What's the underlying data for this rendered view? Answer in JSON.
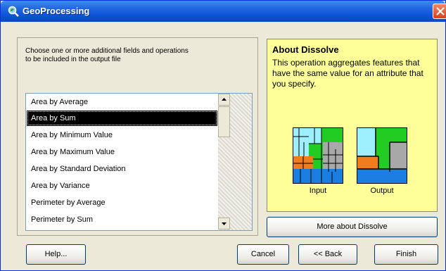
{
  "window": {
    "title": "GeoProcessing"
  },
  "left_panel": {
    "instructions": "Choose one or more additional fields and operations to be included in the output file",
    "list_items": [
      {
        "label": "Area by Average",
        "selected": false
      },
      {
        "label": "Area by Sum",
        "selected": true
      },
      {
        "label": "Area by Minimum Value",
        "selected": false
      },
      {
        "label": "Area by Maximum Value",
        "selected": false
      },
      {
        "label": "Area by Standard Deviation",
        "selected": false
      },
      {
        "label": "Area by Variance",
        "selected": false
      },
      {
        "label": "Perimeter by Average",
        "selected": false
      },
      {
        "label": "Perimeter by Sum",
        "selected": false
      }
    ]
  },
  "info_panel": {
    "title": "About Dissolve",
    "description": "This operation aggregates features that have the same value for an attribute that you specify.",
    "input_label": "Input",
    "output_label": "Output",
    "background_color": "#ffff99"
  },
  "buttons": {
    "more_about": "More about Dissolve",
    "help": "Help...",
    "cancel": "Cancel",
    "back": "<< Back",
    "finish": "Finish"
  },
  "colors": {
    "titlebar": "#0b53d8",
    "selection": "#000000",
    "map_green": "#22cc22",
    "map_orange": "#f07c1e",
    "map_blue": "#1a7fe0",
    "map_cyan": "#9ff0ff",
    "map_gray": "#a8a8a8"
  }
}
